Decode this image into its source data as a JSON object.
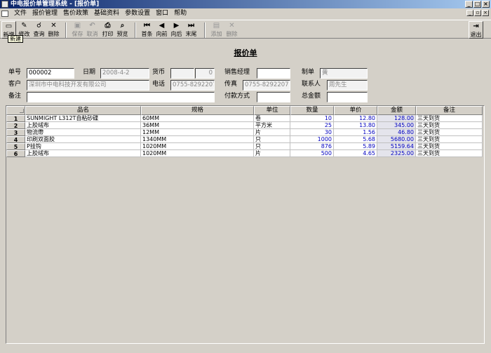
{
  "window": {
    "title": "中电报价单管理系统 - [报价单]",
    "minimize": "_",
    "maximize": "□",
    "close": "×"
  },
  "menu": {
    "items": [
      "文件",
      "报价管理",
      "售价政策",
      "基础资料",
      "参数设置",
      "窗口",
      "帮助"
    ],
    "mdi_min": "_",
    "mdi_restore": "▫",
    "mdi_close": "×"
  },
  "toolbar": {
    "new": "新增",
    "edit": "修改",
    "query": "查询",
    "delete": "删除",
    "save": "保存",
    "cancel": "取消",
    "print": "打印",
    "preview": "预览",
    "first": "首条",
    "prev": "向前",
    "next": "向后",
    "last": "末尾",
    "add_row": "添加",
    "del_row": "删除",
    "exit": "退出",
    "tooltip": "新建"
  },
  "icons": {
    "new": "▭",
    "edit": "✎",
    "query": "☌",
    "delete": "✕",
    "save": "▣",
    "cancel": "↶",
    "print": "⎙",
    "preview": "⌕",
    "first": "⏮",
    "prev": "◀",
    "next": "▶",
    "last": "⏭",
    "add_row": "▤",
    "del_row": "✕",
    "exit": "⇥"
  },
  "form": {
    "title": "报价单",
    "labels": {
      "order_no": "单号",
      "date": "日期",
      "currency": "货币",
      "sales_manager": "销售经理",
      "maker": "制单",
      "customer": "客户",
      "phone": "电话",
      "fax": "传真",
      "contact": "联系人",
      "remark": "备注",
      "payment": "付款方式",
      "total": "总金额"
    },
    "values": {
      "order_no": "000002",
      "date": "2008-4-2",
      "currency": "",
      "currency_rate": "0",
      "sales_manager": "",
      "maker": "黄",
      "customer": "深圳市中电科技开发有限公司",
      "phone": "0755-8292207",
      "fax": "0755-8292207",
      "contact": "周先生",
      "remark": "",
      "payment": "",
      "total": ""
    }
  },
  "grid": {
    "columns": [
      "品名",
      "规格",
      "单位",
      "数量",
      "单价",
      "金额",
      "备注"
    ],
    "rows": [
      {
        "n": "1",
        "name": "SUNMIGHT  L312T自粘砂碟",
        "spec": "60MM",
        "unit": "卷",
        "qty": "10",
        "price": "12.80",
        "amount": "128.00",
        "remark": "三天到货"
      },
      {
        "n": "2",
        "name": "上胶绒布",
        "spec": "36MM",
        "unit": "平方米",
        "qty": "25",
        "price": "13.80",
        "amount": "345.00",
        "remark": "三天到货"
      },
      {
        "n": "3",
        "name": "物流帶",
        "spec": "12MM",
        "unit": "片",
        "qty": "30",
        "price": "1.56",
        "amount": "46.80",
        "remark": "三天到货"
      },
      {
        "n": "4",
        "name": "印刷双面胶",
        "spec": "1340MM",
        "unit": "只",
        "qty": "1000",
        "price": "5.68",
        "amount": "5680.00",
        "remark": "三天到货"
      },
      {
        "n": "5",
        "name": "P挂钩",
        "spec": "1020MM",
        "unit": "只",
        "qty": "876",
        "price": "5.89",
        "amount": "5159.64",
        "remark": "三天到货"
      },
      {
        "n": "6",
        "name": "上胶绒布",
        "spec": "1020MM",
        "unit": "片",
        "qty": "500",
        "price": "4.65",
        "amount": "2325.00",
        "remark": "三天到货"
      }
    ]
  }
}
